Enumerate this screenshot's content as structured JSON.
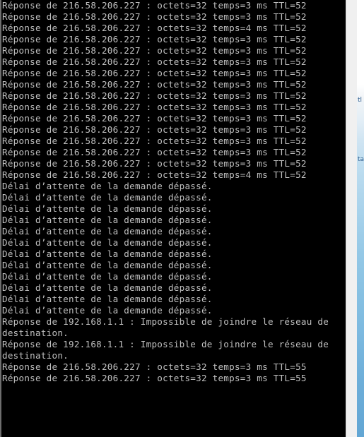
{
  "console": {
    "lines": [
      "Réponse de 216.58.206.227 : octets=32 temps=3 ms TTL=52",
      "Réponse de 216.58.206.227 : octets=32 temps=3 ms TTL=52",
      "Réponse de 216.58.206.227 : octets=32 temps=4 ms TTL=52",
      "Réponse de 216.58.206.227 : octets=32 temps=3 ms TTL=52",
      "Réponse de 216.58.206.227 : octets=32 temps=3 ms TTL=52",
      "Réponse de 216.58.206.227 : octets=32 temps=3 ms TTL=52",
      "Réponse de 216.58.206.227 : octets=32 temps=3 ms TTL=52",
      "Réponse de 216.58.206.227 : octets=32 temps=3 ms TTL=52",
      "Réponse de 216.58.206.227 : octets=32 temps=3 ms TTL=52",
      "Réponse de 216.58.206.227 : octets=32 temps=3 ms TTL=52",
      "Réponse de 216.58.206.227 : octets=32 temps=3 ms TTL=52",
      "Réponse de 216.58.206.227 : octets=32 temps=3 ms TTL=52",
      "Réponse de 216.58.206.227 : octets=32 temps=3 ms TTL=52",
      "Réponse de 216.58.206.227 : octets=32 temps=3 ms TTL=52",
      "Réponse de 216.58.206.227 : octets=32 temps=3 ms TTL=52",
      "Réponse de 216.58.206.227 : octets=32 temps=4 ms TTL=52",
      "Délai d’attente de la demande dépassé.",
      "Délai d’attente de la demande dépassé.",
      "Délai d’attente de la demande dépassé.",
      "Délai d’attente de la demande dépassé.",
      "Délai d’attente de la demande dépassé.",
      "Délai d’attente de la demande dépassé.",
      "Délai d’attente de la demande dépassé.",
      "Délai d’attente de la demande dépassé.",
      "Délai d’attente de la demande dépassé.",
      "Délai d’attente de la demande dépassé.",
      "Délai d’attente de la demande dépassé.",
      "Délai d’attente de la demande dépassé.",
      "Réponse de 192.168.1.1 : Impossible de joindre le réseau de",
      "destination.",
      "Réponse de 192.168.1.1 : Impossible de joindre le réseau de",
      "destination.",
      "Réponse de 216.58.206.227 : octets=32 temps=3 ms TTL=55",
      "Réponse de 216.58.206.227 : octets=32 temps=3 ms TTL=55"
    ],
    "text_color": "#c0c0c0",
    "background_color": "#000000"
  },
  "desktop_edge": {
    "glyph_top": "tl",
    "glyph_mid": "ta"
  }
}
